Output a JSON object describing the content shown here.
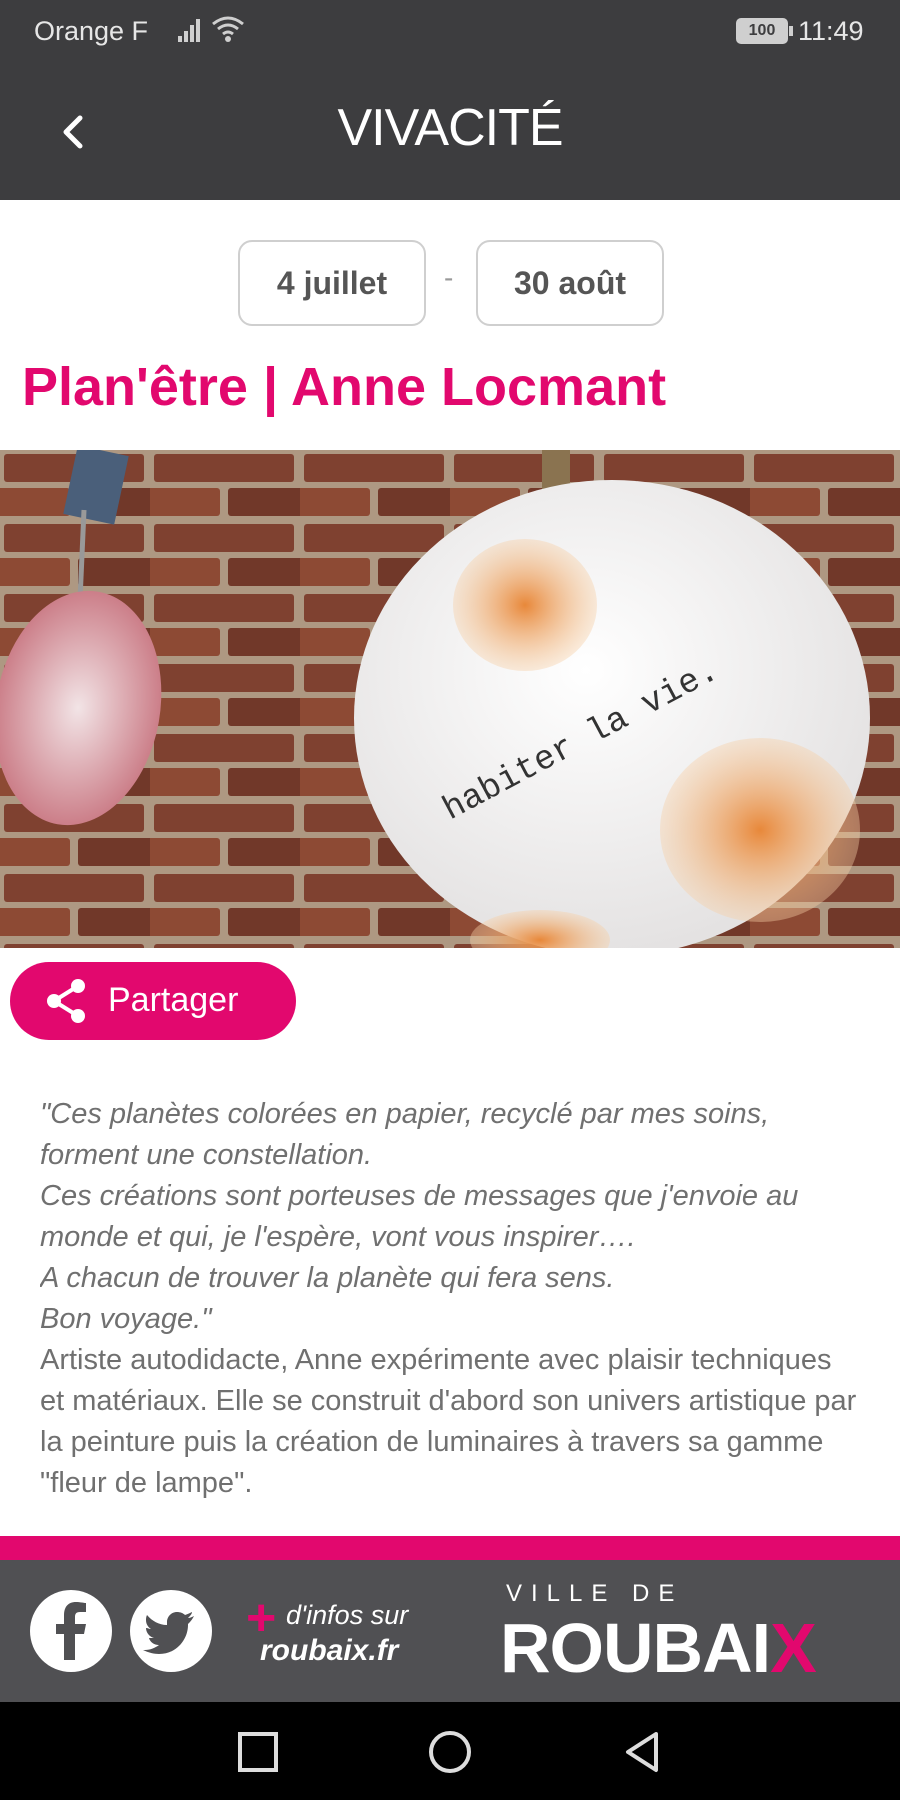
{
  "status_bar": {
    "carrier": "Orange F",
    "battery": "100",
    "time": "11:49"
  },
  "app_bar": {
    "logo": "VIVACITÉ"
  },
  "event": {
    "date_start": "4 juillet",
    "date_separator": "-",
    "date_end": "30 août",
    "title": "Plan'être | Anne Locmant"
  },
  "hero_image": {
    "caption_text": "habiter la vie."
  },
  "share": {
    "label": "Partager"
  },
  "description": {
    "quote": "\"Ces planètes colorées en papier, recyclé par mes soins, forment une constellation.\nCes créations sont porteuses de messages que j'envoie au monde et qui, je l'espère, vont vous inspirer….\nA chacun de trouver la planète qui fera sens.\nBon voyage.\"",
    "body": "Artiste autodidacte, Anne expérimente avec plaisir techniques et matériaux. Elle se construit d'abord son univers artistique par la peinture puis la création de luminaires à travers sa gamme \"fleur de lampe\"."
  },
  "footer": {
    "infos_prefix": "d'infos sur",
    "infos_site": "roubaix.fr",
    "ville_de": "VILLE DE",
    "city": "ROUBAI",
    "city_last": "X",
    "accent_color": "#e2086e"
  },
  "icons": [
    "back-arrow-icon",
    "share-icon",
    "facebook-icon",
    "twitter-icon",
    "nav-recents-icon",
    "nav-home-icon",
    "nav-back-icon"
  ]
}
